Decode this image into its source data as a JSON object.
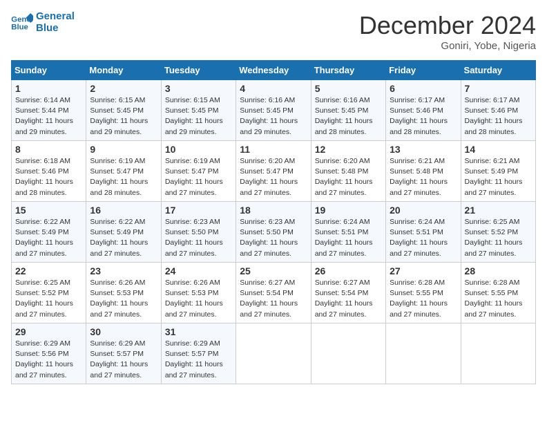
{
  "header": {
    "logo_line1": "General",
    "logo_line2": "Blue",
    "month": "December 2024",
    "location": "Goniri, Yobe, Nigeria"
  },
  "days_of_week": [
    "Sunday",
    "Monday",
    "Tuesday",
    "Wednesday",
    "Thursday",
    "Friday",
    "Saturday"
  ],
  "weeks": [
    [
      {
        "num": "1",
        "sunrise": "6:14 AM",
        "sunset": "5:44 PM",
        "daylight": "11 hours and 29 minutes."
      },
      {
        "num": "2",
        "sunrise": "6:15 AM",
        "sunset": "5:45 PM",
        "daylight": "11 hours and 29 minutes."
      },
      {
        "num": "3",
        "sunrise": "6:15 AM",
        "sunset": "5:45 PM",
        "daylight": "11 hours and 29 minutes."
      },
      {
        "num": "4",
        "sunrise": "6:16 AM",
        "sunset": "5:45 PM",
        "daylight": "11 hours and 29 minutes."
      },
      {
        "num": "5",
        "sunrise": "6:16 AM",
        "sunset": "5:45 PM",
        "daylight": "11 hours and 28 minutes."
      },
      {
        "num": "6",
        "sunrise": "6:17 AM",
        "sunset": "5:46 PM",
        "daylight": "11 hours and 28 minutes."
      },
      {
        "num": "7",
        "sunrise": "6:17 AM",
        "sunset": "5:46 PM",
        "daylight": "11 hours and 28 minutes."
      }
    ],
    [
      {
        "num": "8",
        "sunrise": "6:18 AM",
        "sunset": "5:46 PM",
        "daylight": "11 hours and 28 minutes."
      },
      {
        "num": "9",
        "sunrise": "6:19 AM",
        "sunset": "5:47 PM",
        "daylight": "11 hours and 28 minutes."
      },
      {
        "num": "10",
        "sunrise": "6:19 AM",
        "sunset": "5:47 PM",
        "daylight": "11 hours and 27 minutes."
      },
      {
        "num": "11",
        "sunrise": "6:20 AM",
        "sunset": "5:47 PM",
        "daylight": "11 hours and 27 minutes."
      },
      {
        "num": "12",
        "sunrise": "6:20 AM",
        "sunset": "5:48 PM",
        "daylight": "11 hours and 27 minutes."
      },
      {
        "num": "13",
        "sunrise": "6:21 AM",
        "sunset": "5:48 PM",
        "daylight": "11 hours and 27 minutes."
      },
      {
        "num": "14",
        "sunrise": "6:21 AM",
        "sunset": "5:49 PM",
        "daylight": "11 hours and 27 minutes."
      }
    ],
    [
      {
        "num": "15",
        "sunrise": "6:22 AM",
        "sunset": "5:49 PM",
        "daylight": "11 hours and 27 minutes."
      },
      {
        "num": "16",
        "sunrise": "6:22 AM",
        "sunset": "5:49 PM",
        "daylight": "11 hours and 27 minutes."
      },
      {
        "num": "17",
        "sunrise": "6:23 AM",
        "sunset": "5:50 PM",
        "daylight": "11 hours and 27 minutes."
      },
      {
        "num": "18",
        "sunrise": "6:23 AM",
        "sunset": "5:50 PM",
        "daylight": "11 hours and 27 minutes."
      },
      {
        "num": "19",
        "sunrise": "6:24 AM",
        "sunset": "5:51 PM",
        "daylight": "11 hours and 27 minutes."
      },
      {
        "num": "20",
        "sunrise": "6:24 AM",
        "sunset": "5:51 PM",
        "daylight": "11 hours and 27 minutes."
      },
      {
        "num": "21",
        "sunrise": "6:25 AM",
        "sunset": "5:52 PM",
        "daylight": "11 hours and 27 minutes."
      }
    ],
    [
      {
        "num": "22",
        "sunrise": "6:25 AM",
        "sunset": "5:52 PM",
        "daylight": "11 hours and 27 minutes."
      },
      {
        "num": "23",
        "sunrise": "6:26 AM",
        "sunset": "5:53 PM",
        "daylight": "11 hours and 27 minutes."
      },
      {
        "num": "24",
        "sunrise": "6:26 AM",
        "sunset": "5:53 PM",
        "daylight": "11 hours and 27 minutes."
      },
      {
        "num": "25",
        "sunrise": "6:27 AM",
        "sunset": "5:54 PM",
        "daylight": "11 hours and 27 minutes."
      },
      {
        "num": "26",
        "sunrise": "6:27 AM",
        "sunset": "5:54 PM",
        "daylight": "11 hours and 27 minutes."
      },
      {
        "num": "27",
        "sunrise": "6:28 AM",
        "sunset": "5:55 PM",
        "daylight": "11 hours and 27 minutes."
      },
      {
        "num": "28",
        "sunrise": "6:28 AM",
        "sunset": "5:55 PM",
        "daylight": "11 hours and 27 minutes."
      }
    ],
    [
      {
        "num": "29",
        "sunrise": "6:29 AM",
        "sunset": "5:56 PM",
        "daylight": "11 hours and 27 minutes."
      },
      {
        "num": "30",
        "sunrise": "6:29 AM",
        "sunset": "5:57 PM",
        "daylight": "11 hours and 27 minutes."
      },
      {
        "num": "31",
        "sunrise": "6:29 AM",
        "sunset": "5:57 PM",
        "daylight": "11 hours and 27 minutes."
      },
      null,
      null,
      null,
      null
    ]
  ]
}
